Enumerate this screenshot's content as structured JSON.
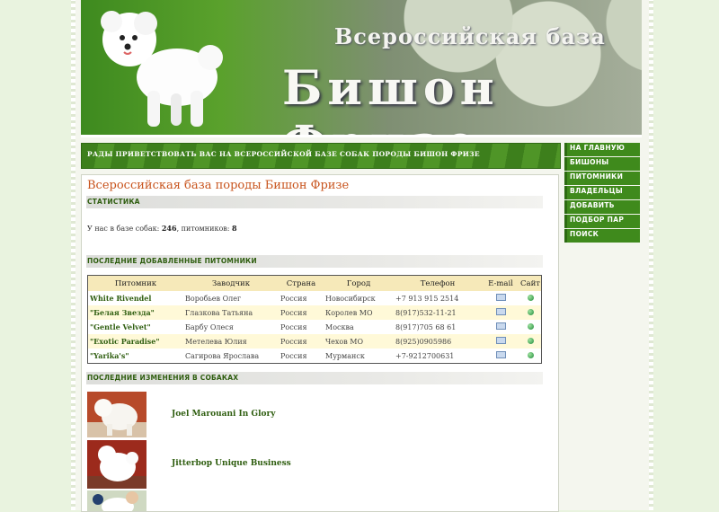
{
  "header": {
    "subtitle": "Всероссийская база",
    "title": "Бишон Фризе"
  },
  "welcome_text": "РАДЫ ПРИВЕТСТВОВАТЬ ВАС НА ВСЕРОССИЙСКОЙ БАЗЕ СОБАК ПОРОДЫ БИШОН ФРИЗЕ",
  "menu": [
    "НА ГЛАВНУЮ",
    "БИШОНЫ",
    "ПИТОМНИКИ",
    "ВЛАДЕЛЬЦЫ",
    "ДОБАВИТЬ",
    "ПОДБОР ПАР",
    "ПОИСК"
  ],
  "content": {
    "heading": "Всероссийская база породы Бишон Фризе",
    "stats_title": "СТАТИСТИКА",
    "stats": {
      "dogs_label": "У нас в базе собак:",
      "dogs_count": "246",
      "kennels_label": ", питомников:",
      "kennels_count": "8"
    },
    "kennels_title": "ПОСЛЕДНИЕ ДОБАВЛЕННЫЕ ПИТОМНИКИ",
    "kennels_columns": [
      "Питомник",
      "Заводчик",
      "Страна",
      "Город",
      "Телефон",
      "E-mail",
      "Сайт"
    ],
    "kennels": [
      {
        "name": "White Rivendel",
        "breeder": "Воробьев Олег",
        "country": "Россия",
        "city": "Новосибирск",
        "phone": "+7 913 915 2514"
      },
      {
        "name": "\"Белая Звезда\"",
        "breeder": "Глазкова Татьяна",
        "country": "Россия",
        "city": "Королев МО",
        "phone": "8(917)532-11-21"
      },
      {
        "name": "\"Gentle Velvet\"",
        "breeder": "Барбу Олеся",
        "country": "Россия",
        "city": "Москва",
        "phone": "8(917)705 68 61"
      },
      {
        "name": "\"Exotic Paradise\"",
        "breeder": "Метелева Юлия",
        "country": "Россия",
        "city": "Чехов МО",
        "phone": "8(925)0905986"
      },
      {
        "name": "\"Yarika's\"",
        "breeder": "Сагирова Ярослава",
        "country": "Россия",
        "city": "Мурманск",
        "phone": "+7-9212700631"
      }
    ],
    "changes_title": "ПОСЛЕДНИЕ ИЗМЕНЕНИЯ В СОБАКАХ",
    "dogs": [
      {
        "name": "Joel Marouani In Glory"
      },
      {
        "name": "Jitterbop Unique Business"
      }
    ]
  }
}
